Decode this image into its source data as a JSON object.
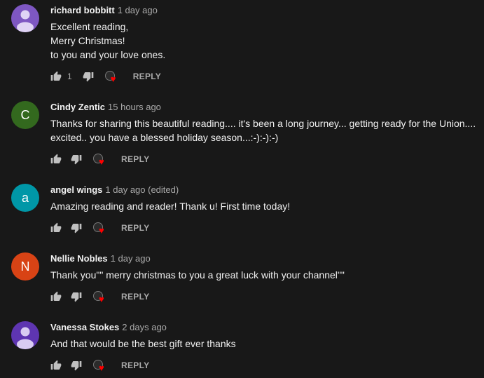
{
  "comments": [
    {
      "author": "richard bobbitt",
      "time": "1 day ago",
      "text": "Excellent reading,\nMerry Christmas!\nto you and your love ones.",
      "like_count": "1",
      "avatar_color": "#7e57c2",
      "avatar_letter": "",
      "reply_label": "REPLY"
    },
    {
      "author": "Cindy Zentic",
      "time": "15 hours ago",
      "text": "Thanks for sharing this beautiful reading.... it's been a long journey... getting ready for the Union....\nexcited.. you have a blessed holiday season...:-):-):-)",
      "like_count": "",
      "avatar_color": "#33691e",
      "avatar_letter": "C",
      "reply_label": "REPLY"
    },
    {
      "author": "angel wings",
      "time": "1 day ago (edited)",
      "text": "Amazing reading and reader!  Thank u! First time today!",
      "like_count": "",
      "avatar_color": "#0097a7",
      "avatar_letter": "a",
      "reply_label": "REPLY"
    },
    {
      "author": "Nellie Nobles",
      "time": "1 day ago",
      "text": "Thank you\"\" merry christmas to you a great luck with your channel\"\"",
      "like_count": "",
      "avatar_color": "#d84315",
      "avatar_letter": "N",
      "reply_label": "REPLY"
    },
    {
      "author": "Vanessa Stokes",
      "time": "2 days ago",
      "text": "And that would be the best gift ever thanks",
      "like_count": "",
      "avatar_color": "#5e35b1",
      "avatar_letter": "",
      "reply_label": "REPLY"
    }
  ],
  "icons": {
    "like": "thumb-up-icon",
    "dislike": "thumb-down-icon",
    "creator_heart": "creator-heart-icon"
  },
  "colors": {
    "background": "#181818",
    "text": "#f1f1f1",
    "secondary_text": "#aaaaaa",
    "heart": "#ff0000"
  }
}
